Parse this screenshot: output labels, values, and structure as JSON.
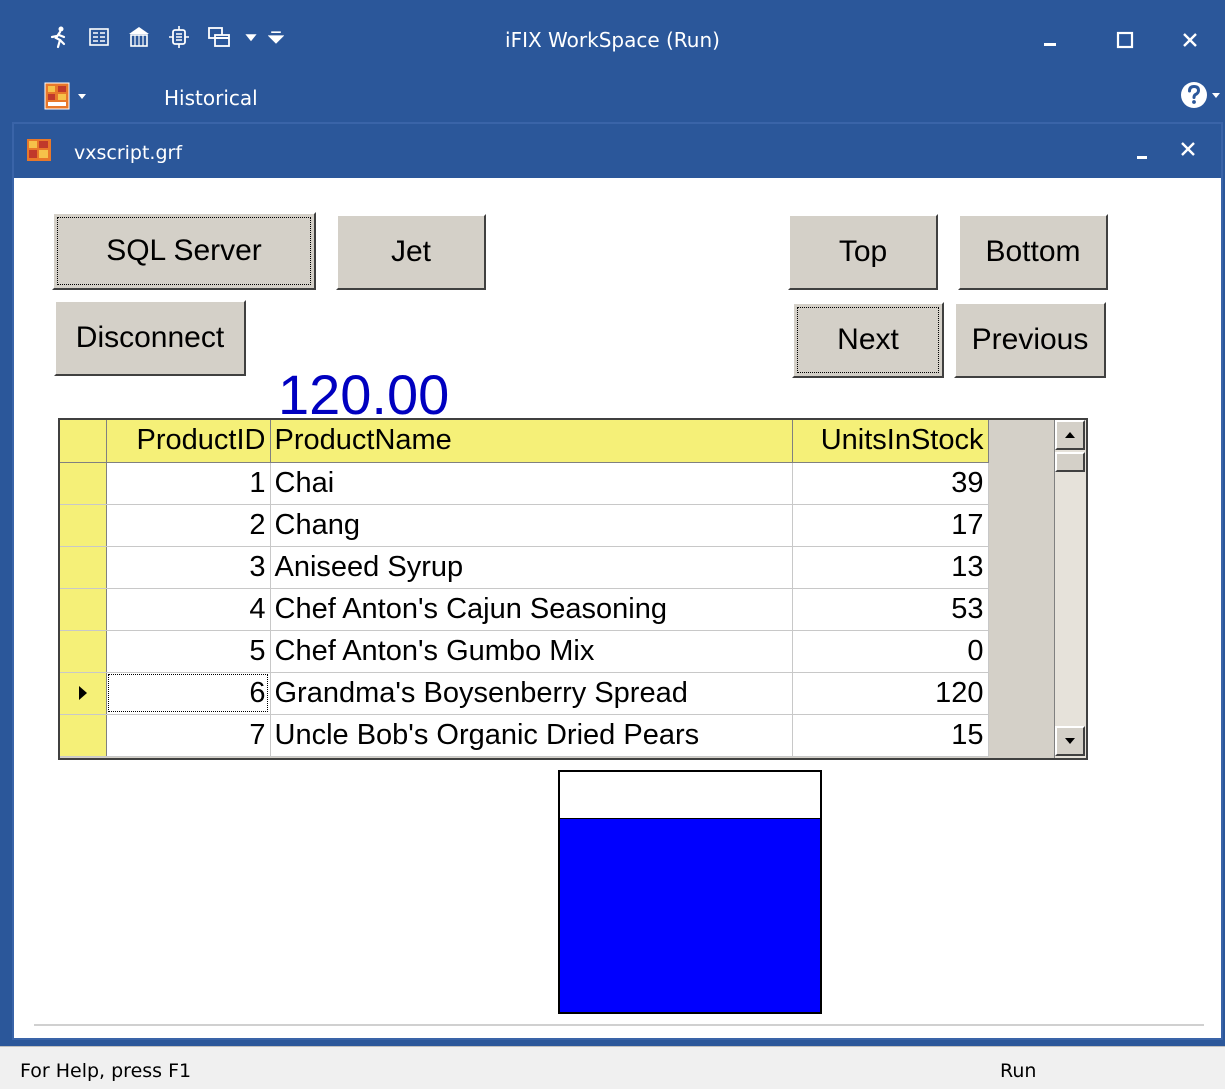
{
  "app": {
    "title": "iFIX WorkSpace (Run)",
    "ribbon_tab": "Historical"
  },
  "document": {
    "name": "vxscript.grf"
  },
  "buttons": {
    "sql_server": "SQL Server",
    "jet": "Jet",
    "top": "Top",
    "bottom": "Bottom",
    "disconnect": "Disconnect",
    "next": "Next",
    "previous": "Previous"
  },
  "value_display": "120.00",
  "grid": {
    "columns": [
      "ProductID",
      "ProductName",
      "UnitsInStock"
    ],
    "rows": [
      {
        "id": "1",
        "name": "Chai",
        "units": "39"
      },
      {
        "id": "2",
        "name": "Chang",
        "units": "17"
      },
      {
        "id": "3",
        "name": "Aniseed Syrup",
        "units": "13"
      },
      {
        "id": "4",
        "name": "Chef Anton's Cajun Seasoning",
        "units": "53"
      },
      {
        "id": "5",
        "name": "Chef Anton's Gumbo Mix",
        "units": "0"
      },
      {
        "id": "6",
        "name": "Grandma's Boysenberry Spread",
        "units": "120"
      },
      {
        "id": "7",
        "name": "Uncle Bob's Organic Dried Pears",
        "units": "15"
      }
    ],
    "current_row": 6
  },
  "tank": {
    "level_fraction": 0.81,
    "fill_color": "#0000ff"
  },
  "status": {
    "help": "For Help, press F1",
    "mode": "Run"
  },
  "colors": {
    "titlebar": "#2b579a",
    "header_yellow": "#f5f078",
    "value_blue": "#0000c0"
  }
}
